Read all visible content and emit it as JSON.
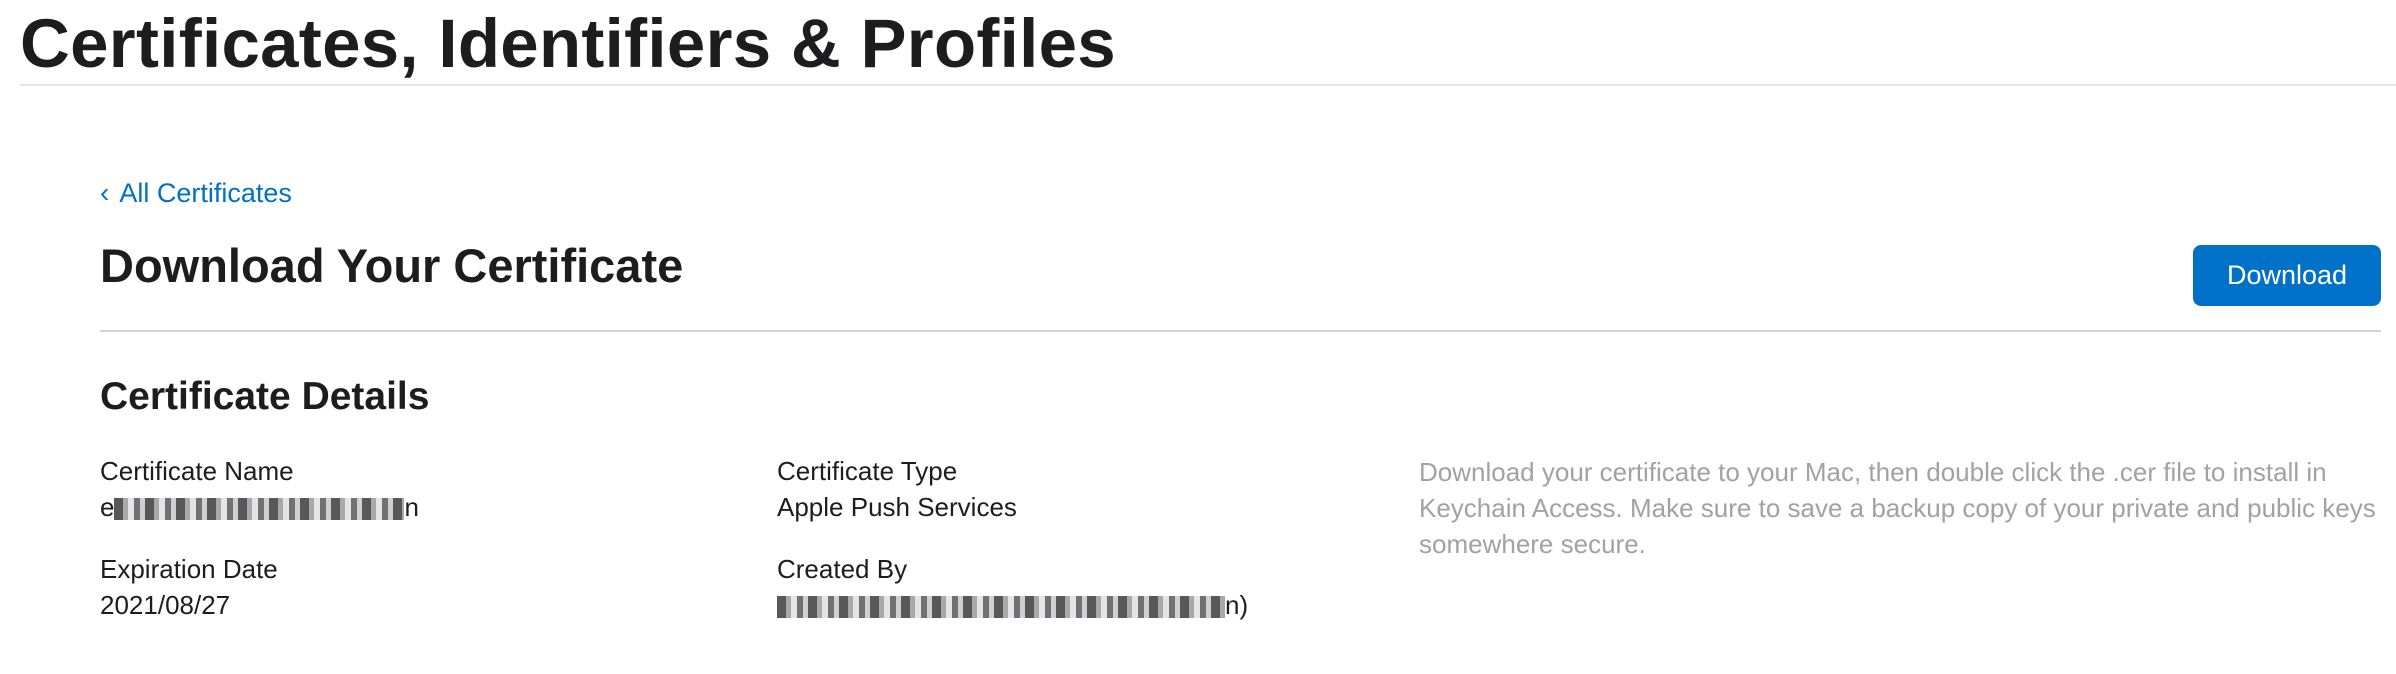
{
  "page": {
    "title": "Certificates, Identifiers & Profiles"
  },
  "nav": {
    "back_chevron": "‹",
    "back_label": "All Certificates"
  },
  "section": {
    "heading": "Download Your Certificate",
    "download_label": "Download"
  },
  "details": {
    "heading": "Certificate Details",
    "certificate_name": {
      "label": "Certificate Name",
      "value_prefix": "e",
      "value_suffix": "n"
    },
    "certificate_type": {
      "label": "Certificate Type",
      "value": "Apple Push Services"
    },
    "expiration_date": {
      "label": "Expiration Date",
      "value": "2021/08/27"
    },
    "created_by": {
      "label": "Created By",
      "value_suffix": "n)"
    }
  },
  "info": {
    "text": "Download your certificate to your Mac, then double click the .cer file to install in Keychain Access. Make sure to save a backup copy of your private and public keys somewhere secure."
  },
  "colors": {
    "accent": "#0071c9",
    "link": "#0070c9",
    "text": "#1d1d1f",
    "muted": "#a1a1a6",
    "rule": "#d2d2d7"
  }
}
